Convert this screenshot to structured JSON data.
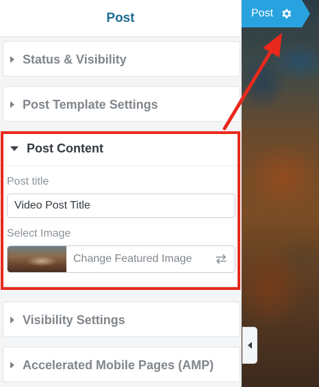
{
  "panel": {
    "title": "Post"
  },
  "post_tab": {
    "label": "Post",
    "icon": "gear-icon",
    "color": "#29a3df"
  },
  "sections": [
    {
      "label": "Status & Visibility",
      "expanded": false
    },
    {
      "label": "Post Template Settings",
      "expanded": false
    },
    {
      "label": "Post Content",
      "expanded": true
    },
    {
      "label": "Visibility Settings",
      "expanded": false
    },
    {
      "label": "Accelerated Mobile Pages (AMP)",
      "expanded": false
    }
  ],
  "post_content": {
    "title_label": "Post title",
    "title_value": "Video Post Title",
    "image_label": "Select Image",
    "change_image_label": "Change Featured Image"
  },
  "annotation": {
    "highlight_color": "#e8291c"
  }
}
